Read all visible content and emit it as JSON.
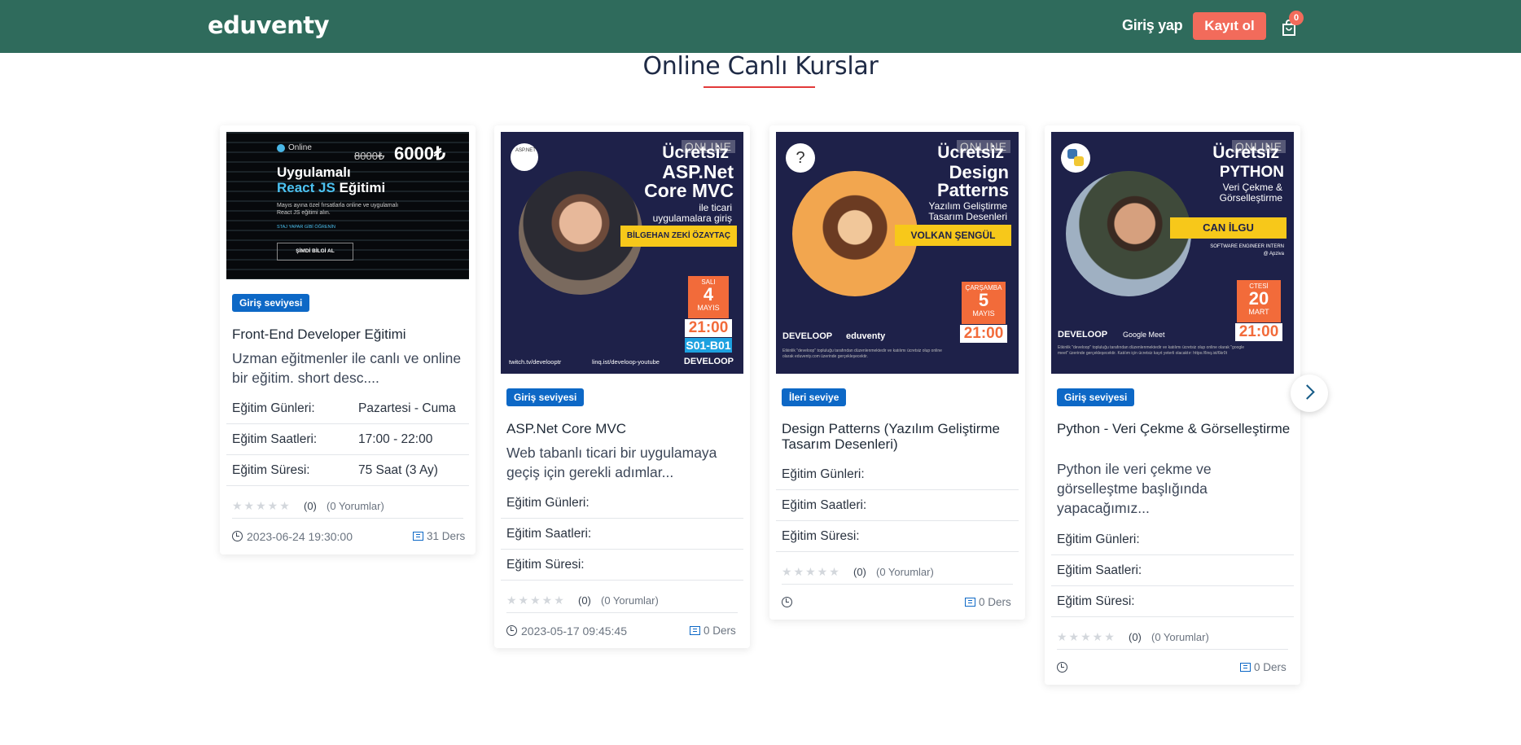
{
  "header": {
    "logo": "eduventy",
    "login": "Giriş yap",
    "register": "Kayıt ol",
    "cart_count": "0"
  },
  "section_title": "Online Canlı Kurslar",
  "rating_stars": "★★★★★",
  "cards": [
    {
      "banner": {
        "online": "Online",
        "old_price": "8000₺",
        "price": "6000₺",
        "title_line1": "Uygulamalı",
        "title_line2_hl": "React JS",
        "title_line2_rest": "Eğitimi",
        "desc": "Mayıs ayına özel fırsatlarla online ve uygulamalı React JS eğitimi alın.",
        "small": "STAJ YAPAR GİBİ ÖĞRENİN",
        "cta": "ŞİMDİ BİLGİ AL"
      },
      "level": "Giriş seviyesi",
      "title": "Front-End Developer Eğitimi",
      "description": "Uzman eğitmenler ile canlı ve online bir eğitim. short desc....",
      "days_label": "Eğitim Günleri:",
      "days": "Pazartesi - Cuma",
      "hours_label": "Eğitim Saatleri:",
      "hours": "17:00 - 22:00",
      "duration_label": "Eğitim Süresi:",
      "duration": "75 Saat (3 Ay)",
      "rating": "(0)",
      "reviews": "(0 Yorumlar)",
      "date": "2023-06-24 19:30:00",
      "lessons": "31 Ders"
    },
    {
      "banner": {
        "logo_text": "ASP.NET",
        "online": "ONLINE",
        "free": "Ücretsiz",
        "h1": "ASP.Net",
        "h2": "Core MVC",
        "sub1": "ile ticari",
        "sub2": "uygulamalara giriş",
        "name": "BİLGEHAN ZEKİ ÖZAYTAÇ",
        "day": "SALI",
        "num": "4",
        "month": "MAYIS",
        "time": "21:00",
        "code": "S01-B01",
        "twitch": "twitch.tv/develooptr",
        "youtube": "linq.ist/develoop-youtube",
        "brand": "DEVELOOP"
      },
      "level": "Giriş seviyesi",
      "title": "ASP.Net Core MVC",
      "description": "Web tabanlı ticari bir uygulamaya geçiş için gerekli adımlar...",
      "days_label": "Eğitim Günleri:",
      "hours_label": "Eğitim Saatleri:",
      "duration_label": "Eğitim Süresi:",
      "rating": "(0)",
      "reviews": "(0 Yorumlar)",
      "date": "2023-05-17 09:45:45",
      "lessons": "0 Ders"
    },
    {
      "banner": {
        "online": "ONLINE",
        "free": "Ücretsiz",
        "h1": "Design",
        "h2": "Patterns",
        "sub1": "Yazılım Geliştirme",
        "sub2": "Tasarım Desenleri",
        "name": "VOLKAN ŞENGÜL",
        "day": "ÇARŞAMBA",
        "num": "5",
        "month": "MAYIS",
        "time": "21:00",
        "brand": "DEVELOOP",
        "brand2": "eduventy",
        "note": "Etkinlik \"develoop\" topluluğu tarafından düzenlenmektedir ve katılımı ücretsiz olup online olarak eduventy.com üzerinde gerçekleşecektir."
      },
      "level": "İleri seviye",
      "title": "Design Patterns (Yazılım Geliştirme Tasarım Desenleri)",
      "description": "",
      "days_label": "Eğitim Günleri:",
      "hours_label": "Eğitim Saatleri:",
      "duration_label": "Eğitim Süresi:",
      "rating": "(0)",
      "reviews": "(0 Yorumlar)",
      "date": "",
      "lessons": "0 Ders"
    },
    {
      "banner": {
        "online": "ONLINE",
        "free": "Ücretsiz",
        "h1": "PYTHON",
        "sub1": "Veri Çekme &",
        "sub2": "Görselleştirme",
        "name": "CAN İLGU",
        "role1": "SOFTWARE ENGINEER INTERN",
        "role2": "@ Apziva",
        "day": "CTESİ",
        "num": "20",
        "month": "MART",
        "time": "21:00",
        "brand": "DEVELOOP",
        "brand2": "Google Meet",
        "note": "Etkinlik \"develoop\" topluluğu tarafından düzenlenmektedir ve katılımı ücretsiz olup online olarak \"google meet\" üzerinde gerçekleşecektir. Katılım için ücretsiz kayıt yeterli olacaktır: https://linq.ist/6kr0t"
      },
      "level": "Giriş seviyesi",
      "title": "Python - Veri Çekme & Görselleştirme",
      "description": "Python ile veri çekme ve görselleştme başlığında yapacağımız...",
      "days_label": "Eğitim Günleri:",
      "hours_label": "Eğitim Saatleri:",
      "duration_label": "Eğitim Süresi:",
      "rating": "(0)",
      "reviews": "(0 Yorumlar)",
      "date": "",
      "lessons": "0 Ders"
    }
  ],
  "colors": {
    "header_bg": "#2f6b5c",
    "accent": "#f26b5b",
    "badge_blue": "#0d68c6",
    "banner_navy": "#1e2149",
    "banner_yellow": "#f7c81a"
  },
  "icons": [
    "shopping-bag-icon",
    "clock-icon",
    "book-icon",
    "star-icon",
    "chevron-right-icon"
  ]
}
